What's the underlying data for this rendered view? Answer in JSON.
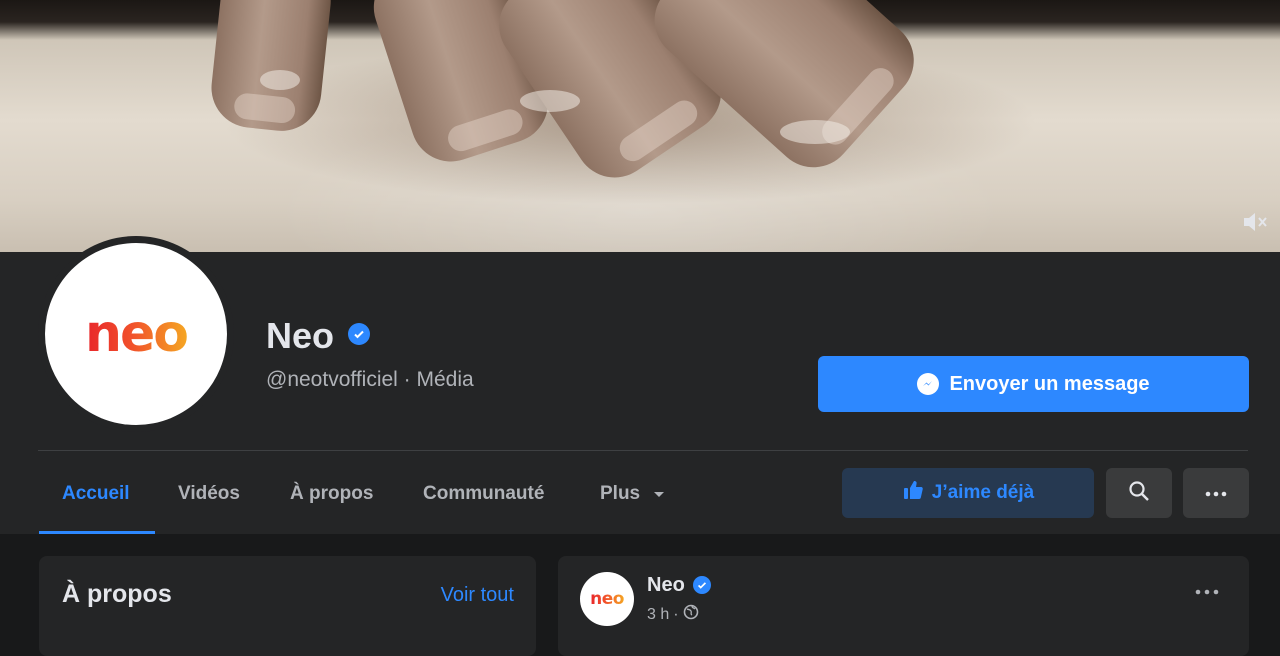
{
  "cover": {
    "mute_icon": "speaker-muted-icon"
  },
  "profile": {
    "logo_text": "neo",
    "name": "Neo",
    "verified_icon": "verified-check-icon",
    "handle_line": "@neotvofficiel · Média"
  },
  "actions": {
    "message_button": "Envoyer un message",
    "like_button": "J’aime déjà",
    "search_icon": "search-icon",
    "more_icon": "more-dots-icon"
  },
  "tabs": [
    {
      "label": "Accueil",
      "active": true
    },
    {
      "label": "Vidéos"
    },
    {
      "label": "À propos"
    },
    {
      "label": "Communauté"
    },
    {
      "label": "Plus"
    }
  ],
  "about_card": {
    "title": "À propos",
    "see_all": "Voir tout"
  },
  "post": {
    "author": "Neo",
    "time": "3 h",
    "separator": "·",
    "privacy_icon": "globe-icon",
    "logo_text": "neo"
  },
  "colors": {
    "accent": "#2d88ff",
    "page_bg": "#18191a",
    "surface": "#242526",
    "like_bg": "#263951"
  }
}
